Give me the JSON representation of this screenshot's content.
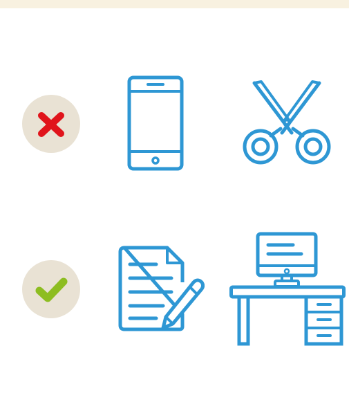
{
  "colors": {
    "top_bar": "#f8f1e0",
    "status_circle": "#e9e2d4",
    "icon_stroke": "#2e97d4",
    "wrong_mark": "#e0141b",
    "right_mark": "#8dbd21"
  },
  "rows": [
    {
      "status": "not-allowed",
      "status_icon": "cross-icon",
      "items": [
        "smartphone-icon",
        "scissors-icon"
      ]
    },
    {
      "status": "allowed",
      "status_icon": "checkmark-icon",
      "items": [
        "document-pen-icon",
        "computer-desk-icon"
      ]
    }
  ]
}
